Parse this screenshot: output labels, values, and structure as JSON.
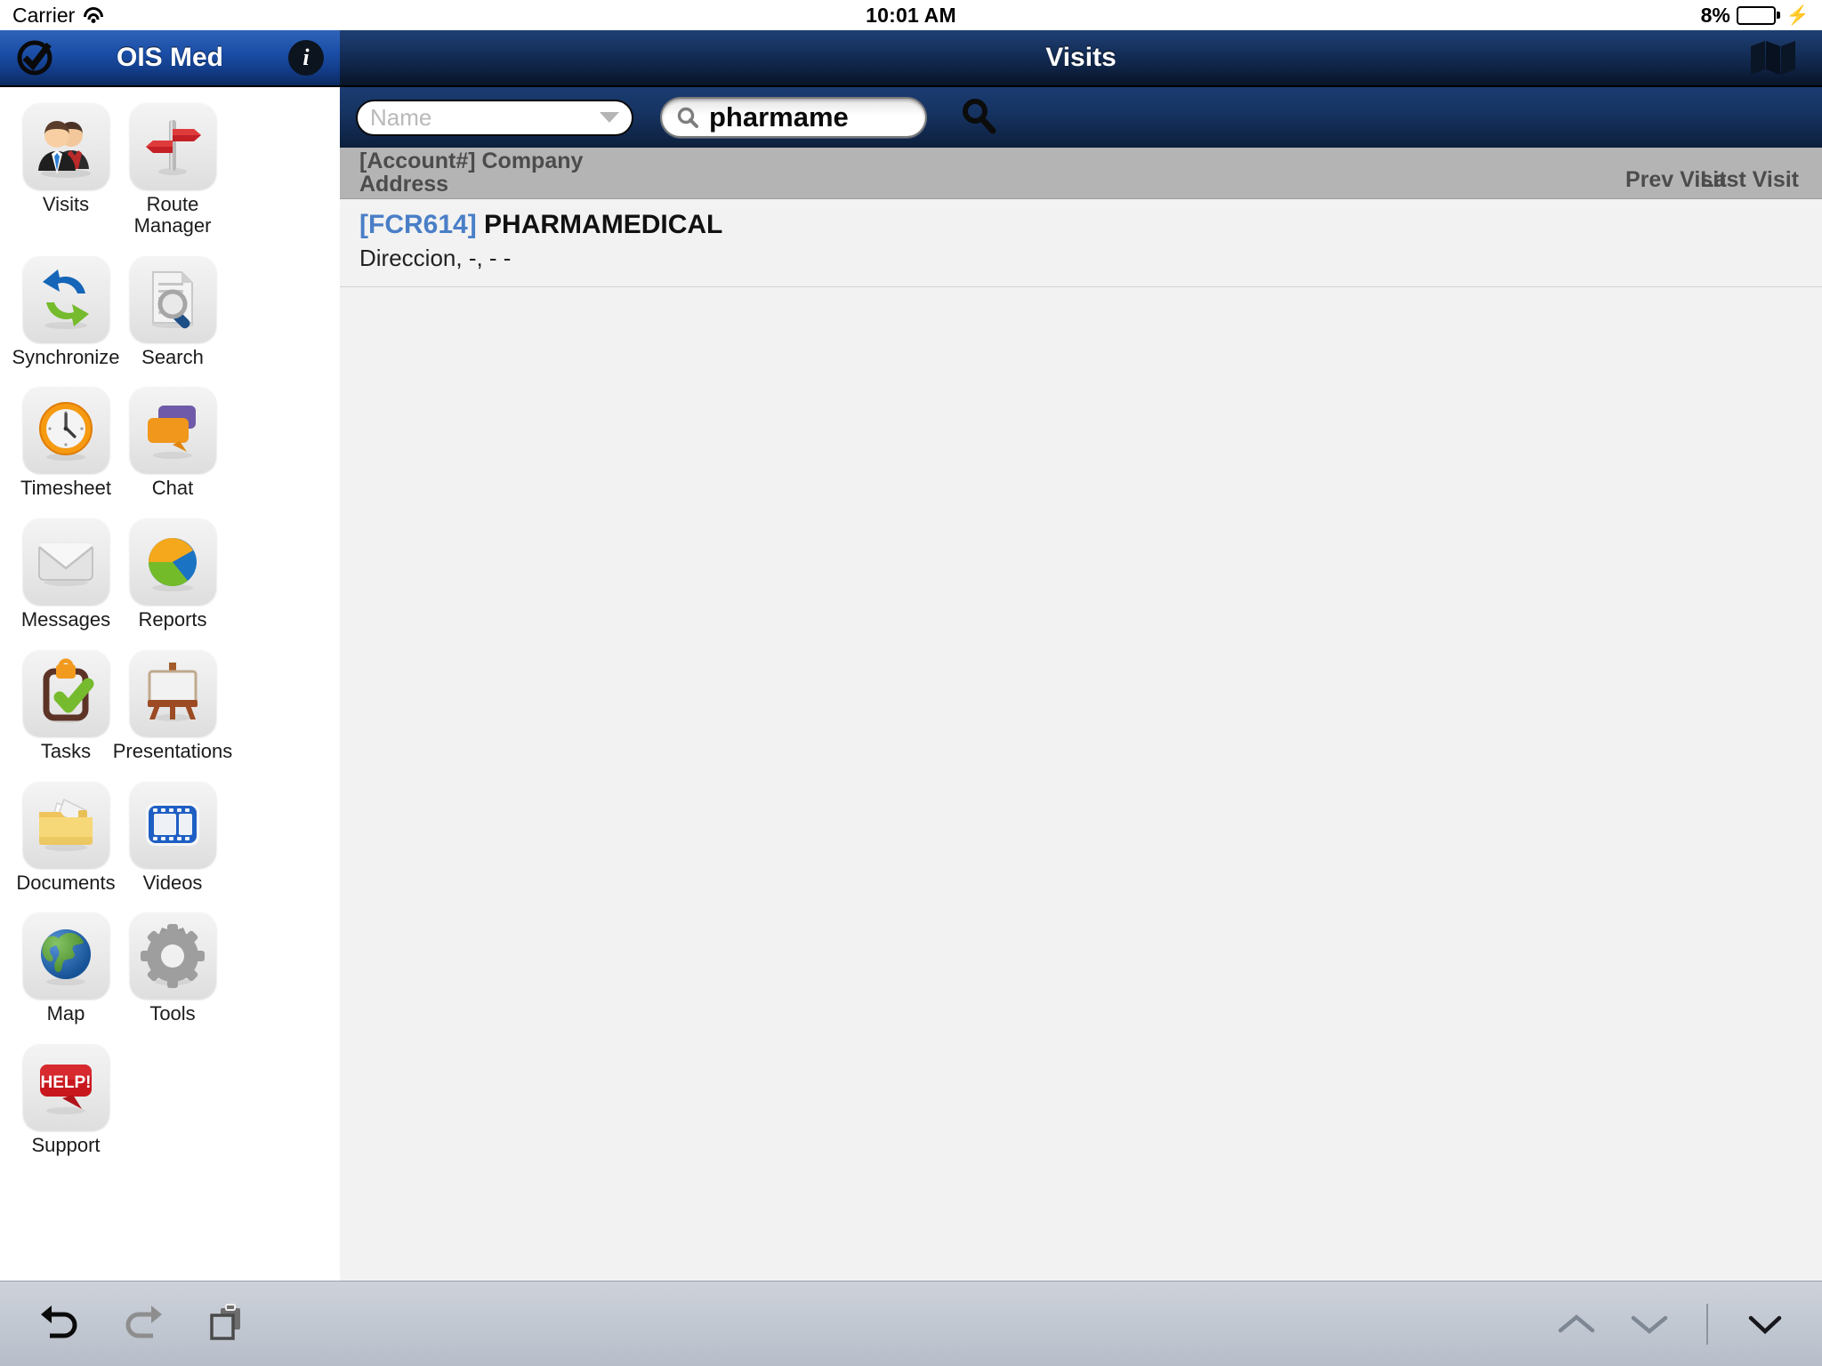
{
  "status_bar": {
    "carrier": "Carrier",
    "wifi_icon": "wifi-icon",
    "time": "10:01 AM",
    "battery_percent": "8%",
    "battery_level": 8,
    "charging_icon": "lightning-bolt-icon"
  },
  "left_panel": {
    "logo_icon": "check-circle-logo-icon",
    "title": "OIS Med",
    "info_icon": "info-icon",
    "menu_items": [
      {
        "label": "Visits",
        "icon": "users-icon"
      },
      {
        "label": "Route Manager",
        "icon": "signpost-icon"
      },
      {
        "label": "Synchronize",
        "icon": "sync-arrows-icon"
      },
      {
        "label": "Search",
        "icon": "document-magnifier-icon"
      },
      {
        "label": "Timesheet",
        "icon": "clock-icon"
      },
      {
        "label": "Chat",
        "icon": "speech-bubbles-icon"
      },
      {
        "label": "Messages",
        "icon": "envelope-icon"
      },
      {
        "label": "Reports",
        "icon": "pie-chart-icon"
      },
      {
        "label": "Tasks",
        "icon": "clipboard-check-icon"
      },
      {
        "label": "Presentations",
        "icon": "easel-icon"
      },
      {
        "label": "Documents",
        "icon": "folder-documents-icon"
      },
      {
        "label": "Videos",
        "icon": "film-strip-icon"
      },
      {
        "label": "Map",
        "icon": "globe-icon"
      },
      {
        "label": "Tools",
        "icon": "gear-icon"
      },
      {
        "label": "Support",
        "icon": "help-bubble-icon"
      }
    ]
  },
  "right_panel": {
    "title": "Visits",
    "map_icon": "folded-map-icon",
    "filter_dropdown": {
      "value": "",
      "placeholder": "Name",
      "caret_icon": "chevron-down-icon"
    },
    "search": {
      "value": "pharmame",
      "placeholder": "",
      "field_icon": "search-icon",
      "submit_icon": "search-icon"
    },
    "columns": {
      "account_company": "[Account#] Company",
      "address": "Address",
      "prev_visit": "Prev Visit",
      "last_visit": "Last Visit"
    },
    "results": [
      {
        "account": "[FCR614]",
        "company": "PHARMAMEDICAL",
        "address": "Direccion, -, - -",
        "prev_visit": "",
        "last_visit": ""
      }
    ]
  },
  "keyboard_toolbar": {
    "undo_icon": "undo-icon",
    "redo_icon": "redo-icon",
    "paste_icon": "paste-icon",
    "prev_field_icon": "chevron-up-icon",
    "next_field_icon": "chevron-down-icon",
    "dismiss_icon": "chevron-down-icon"
  },
  "colors": {
    "left_header_blue": "#1b4fa8",
    "right_header_blue": "#16315d",
    "column_header_gray": "#b4b4b4",
    "account_link_blue": "#4a7ec7",
    "battery_red": "#ee1c24",
    "toolbar_gray": "#c2c8d2"
  }
}
